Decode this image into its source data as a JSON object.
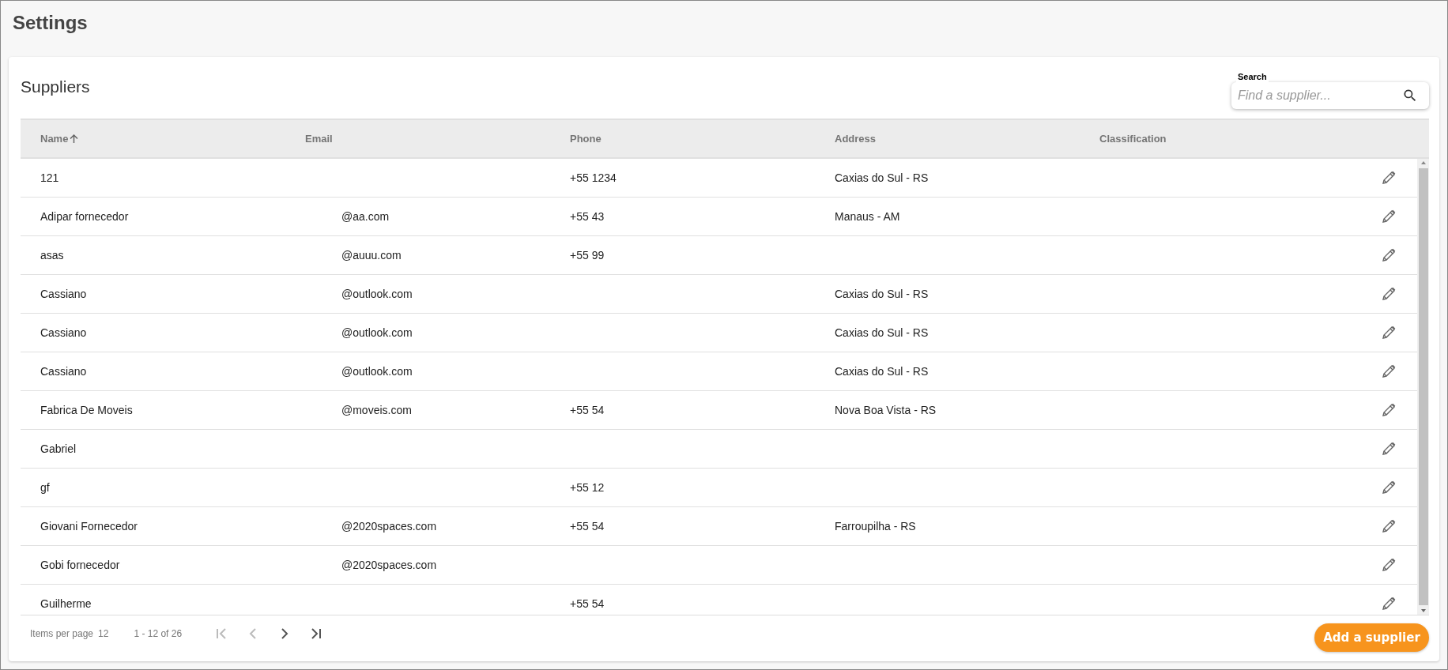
{
  "page": {
    "title": "Settings"
  },
  "card": {
    "title": "Suppliers"
  },
  "search": {
    "label": "Search",
    "placeholder": "Find a supplier..."
  },
  "table": {
    "columns": [
      {
        "label": "Name",
        "sorted": true
      },
      {
        "label": "Email",
        "sorted": false
      },
      {
        "label": "Phone",
        "sorted": false
      },
      {
        "label": "Address",
        "sorted": false
      },
      {
        "label": "Classification",
        "sorted": false
      }
    ],
    "rows": [
      {
        "name": "121",
        "email": "",
        "phone": "+55 1234",
        "address": "Caxias do Sul - RS"
      },
      {
        "name": "Adipar fornecedor",
        "email": "@aa.com",
        "phone": "+55 43",
        "address": "Manaus - AM"
      },
      {
        "name": "asas",
        "email": "@auuu.com",
        "phone": "+55 99",
        "address": ""
      },
      {
        "name": "Cassiano",
        "email": "@outlook.com",
        "phone": "",
        "address": "Caxias do Sul - RS"
      },
      {
        "name": "Cassiano",
        "email": "@outlook.com",
        "phone": "",
        "address": "Caxias do Sul - RS"
      },
      {
        "name": "Cassiano",
        "email": "@outlook.com",
        "phone": "",
        "address": "Caxias do Sul - RS"
      },
      {
        "name": "Fabrica De Moveis",
        "email": "@moveis.com",
        "phone": "+55 54",
        "address": "Nova Boa Vista - RS"
      },
      {
        "name": "Gabriel",
        "email": "",
        "phone": "",
        "address": ""
      },
      {
        "name": "gf",
        "email": "",
        "phone": "+55 12",
        "address": ""
      },
      {
        "name": "Giovani Fornecedor",
        "email": "@2020spaces.com",
        "phone": "+55 54",
        "address": "Farroupilha - RS"
      },
      {
        "name": "Gobi fornecedor",
        "email": "@2020spaces.com",
        "phone": "",
        "address": ""
      },
      {
        "name": "Guilherme",
        "email": "",
        "phone": "+55 54",
        "address": ""
      }
    ]
  },
  "paginator": {
    "items_label": "Items per page",
    "page_size": "12",
    "range": "1 - 12 of 26",
    "buttons": [
      {
        "kind": "first",
        "disabled": true
      },
      {
        "kind": "previous",
        "disabled": true
      },
      {
        "kind": "next",
        "disabled": false
      },
      {
        "kind": "last",
        "disabled": false
      }
    ]
  },
  "add_button": "Add a supplier"
}
